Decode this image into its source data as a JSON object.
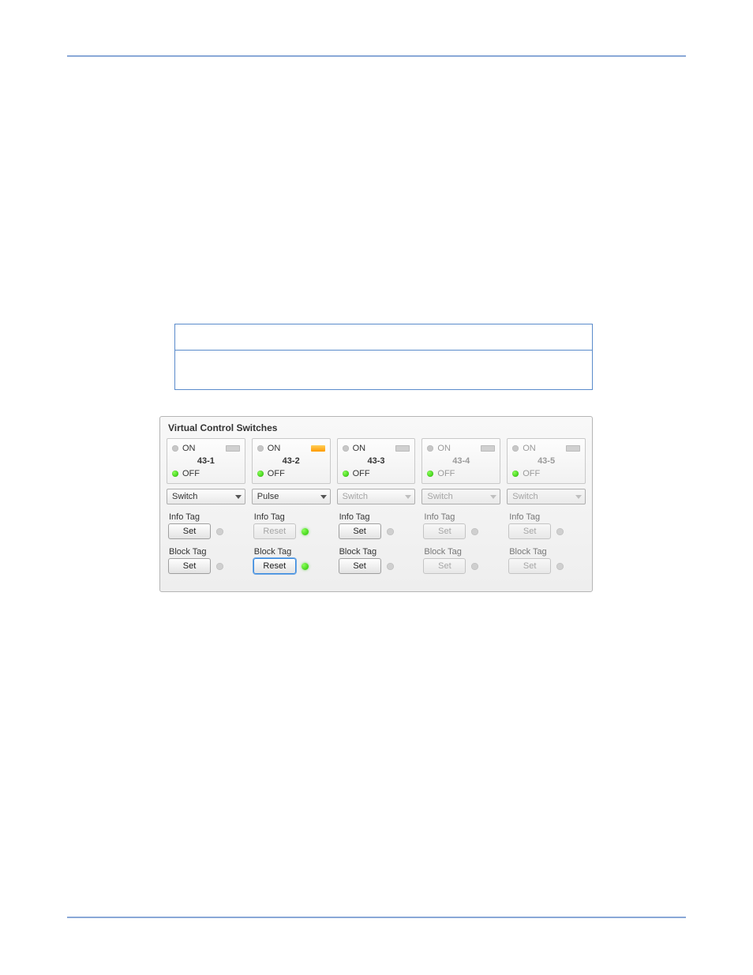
{
  "panel": {
    "title": "Virtual Control Switches",
    "on_label": "ON",
    "off_label": "OFF",
    "info_tag_label": "Info Tag",
    "block_tag_label": "Block Tag",
    "set_label": "Set",
    "reset_label": "Reset",
    "switches": [
      {
        "id": "43-1",
        "enabled": true,
        "on_dot": "grey",
        "off_dot": "green",
        "tally": "grey",
        "mode": "Switch",
        "info_btn": "Set",
        "info_ind": "grey",
        "block_btn": "Set",
        "block_ind": "grey",
        "block_focus": false
      },
      {
        "id": "43-2",
        "enabled": true,
        "on_dot": "grey",
        "off_dot": "green",
        "tally": "orange",
        "mode": "Pulse",
        "info_btn": "Reset",
        "info_btn_disabled": true,
        "info_ind": "green",
        "block_btn": "Reset",
        "block_ind": "green",
        "block_focus": true
      },
      {
        "id": "43-3",
        "enabled": true,
        "on_dot": "grey",
        "off_dot": "green",
        "tally": "grey",
        "mode": "Switch",
        "mode_disabled": true,
        "info_btn": "Set",
        "info_ind": "grey",
        "block_btn": "Set",
        "block_ind": "grey",
        "block_focus": false
      },
      {
        "id": "43-4",
        "enabled": false,
        "on_dot": "grey",
        "off_dot": "green",
        "tally": "grey",
        "mode": "Switch",
        "info_btn": "Set",
        "info_ind": "grey",
        "block_btn": "Set",
        "block_ind": "grey",
        "block_focus": false
      },
      {
        "id": "43-5",
        "enabled": false,
        "on_dot": "grey",
        "off_dot": "green",
        "tally": "grey",
        "mode": "Switch",
        "info_btn": "Set",
        "info_ind": "grey",
        "block_btn": "Set",
        "block_ind": "grey",
        "block_focus": false
      }
    ]
  }
}
